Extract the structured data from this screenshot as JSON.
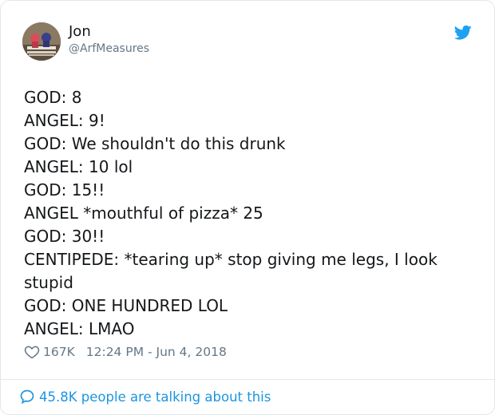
{
  "author": {
    "name": "Jon",
    "handle": "@ArfMeasures"
  },
  "platform_icon": "twitter-bird-icon",
  "tweet": {
    "lines": [
      "GOD: 8",
      "ANGEL: 9!",
      "GOD: We shouldn't do this drunk",
      "ANGEL: 10 lol",
      "GOD: 15!!",
      "ANGEL *mouthful of pizza* 25",
      "GOD: 30!!",
      "CENTIPEDE: *tearing up* stop giving me legs, I look",
      "stupid",
      "GOD: ONE HUNDRED LOL",
      "ANGEL: LMAO"
    ]
  },
  "meta": {
    "like_icon": "heart-outline-icon",
    "likes": "167K",
    "timestamp": "12:24 PM - Jun 4, 2018"
  },
  "footer": {
    "icon": "speech-bubble-icon",
    "talking": "45.8K people are talking about this"
  },
  "colors": {
    "accent": "#1b95e0",
    "text": "#14171a",
    "secondary": "#657786",
    "border": "#e1e8ed"
  }
}
